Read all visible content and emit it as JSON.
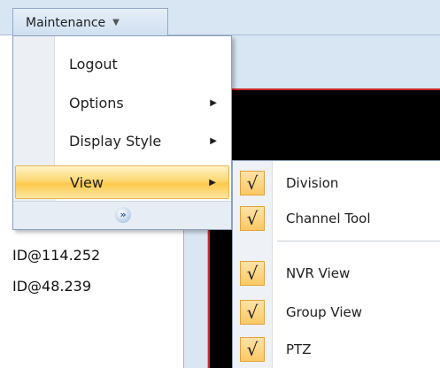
{
  "menu": {
    "title": "Maintenance",
    "chevron": "▼"
  },
  "dropdown": {
    "items": [
      {
        "label": "Logout",
        "arrow": ""
      },
      {
        "label": "Options",
        "arrow": "▶"
      },
      {
        "label": "Display Style",
        "arrow": "▶"
      },
      {
        "label": "View",
        "arrow": "▶"
      }
    ],
    "expand_glyph": "»"
  },
  "submenu": {
    "check_glyph": "√",
    "items": [
      {
        "label": "Division",
        "checked": true
      },
      {
        "label": "Channel Tool",
        "checked": true
      },
      {
        "label": "NVR View",
        "checked": true
      },
      {
        "label": "Group View",
        "checked": true
      },
      {
        "label": "PTZ",
        "checked": true
      }
    ]
  },
  "background_list": {
    "rows": [
      "ID@114.252",
      "ID@48.239"
    ]
  },
  "colors": {
    "highlight": "#fcd873",
    "accent_border": "#c62828",
    "panel_blue": "#d8e5f3"
  }
}
